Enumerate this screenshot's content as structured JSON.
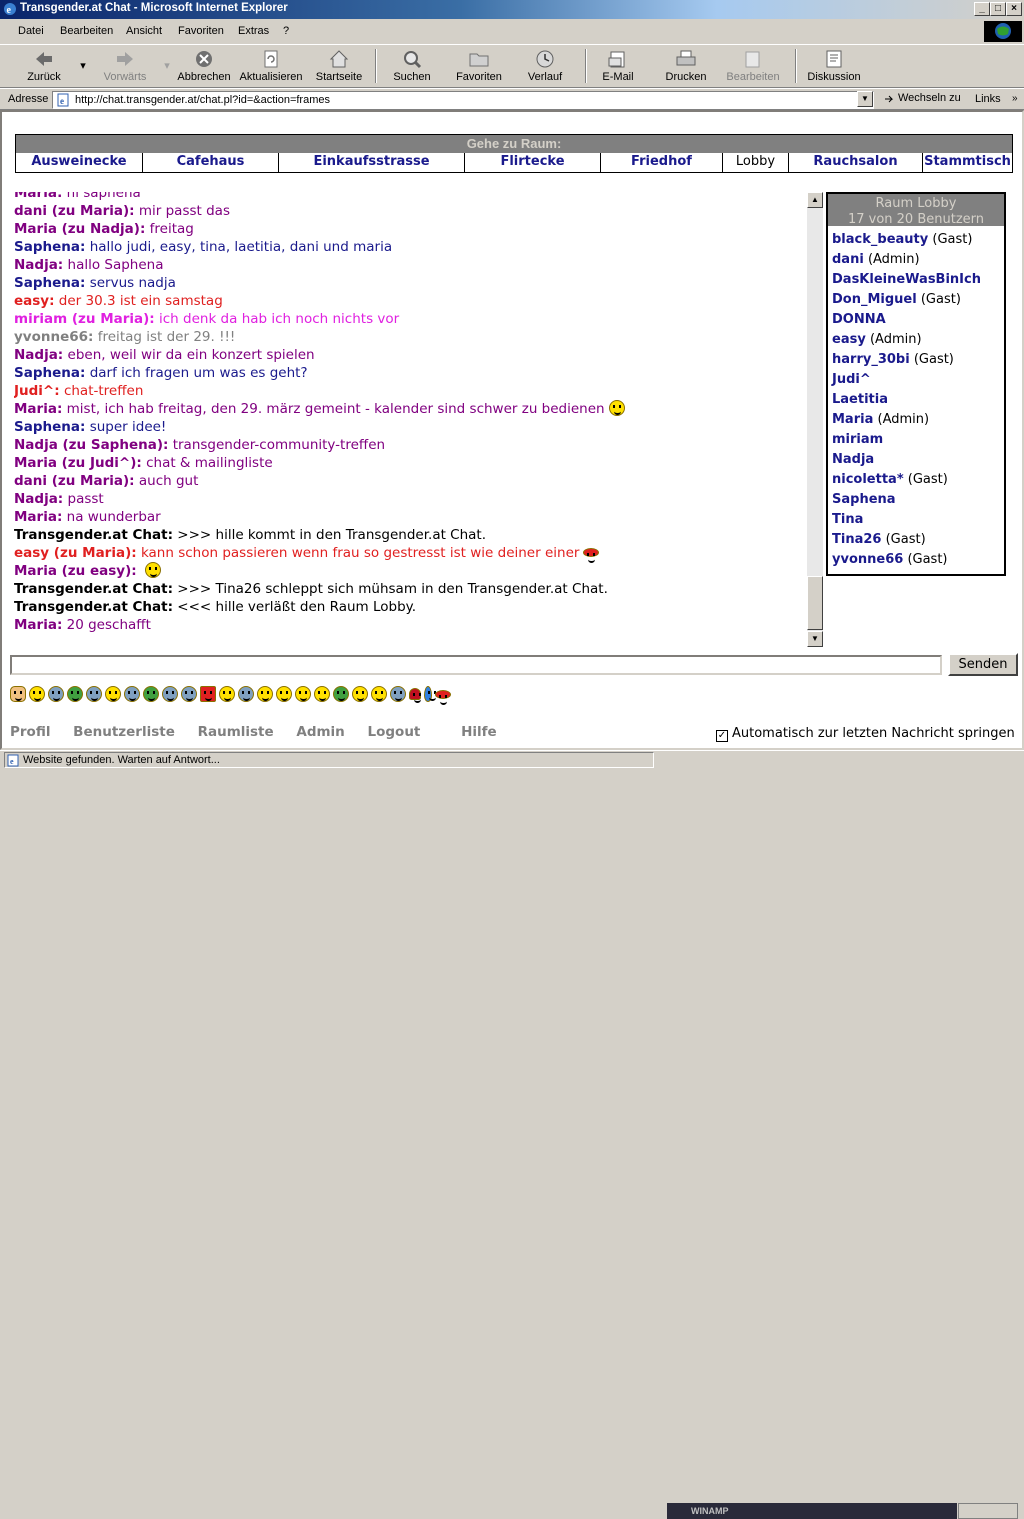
{
  "window": {
    "title": "Transgender.at Chat - Microsoft Internet Explorer"
  },
  "menu": [
    "Datei",
    "Bearbeiten",
    "Ansicht",
    "Favoriten",
    "Extras",
    "?"
  ],
  "toolbar": {
    "back": "Zurück",
    "forward": "Vorwärts",
    "stop": "Abbrechen",
    "refresh": "Aktualisieren",
    "home": "Startseite",
    "search": "Suchen",
    "favorites": "Favoriten",
    "history": "Verlauf",
    "mail": "E-Mail",
    "print": "Drucken",
    "edit": "Bearbeiten",
    "discuss": "Diskussion"
  },
  "address": {
    "label": "Adresse",
    "url": "http://chat.transgender.at/chat.pl?id=&action=frames",
    "go": "Wechseln zu",
    "links": "Links"
  },
  "rooms": {
    "header": "Gehe zu Raum:",
    "items": [
      "Ausweinecke",
      "Cafehaus",
      "Einkaufsstrasse",
      "Flirtecke",
      "Friedhof",
      "Lobby",
      "Rauchsalon",
      "Stammtisch"
    ],
    "current": "Lobby"
  },
  "chat": [
    {
      "who": "Maria:",
      "text": "hi saphena",
      "color": "#800080"
    },
    {
      "who": "dani (zu Maria):",
      "text": "mir passt das",
      "color": "#800080"
    },
    {
      "who": "Maria (zu Nadja):",
      "text": "freitag",
      "color": "#800080"
    },
    {
      "who": "Saphena:",
      "text": "hallo judi, easy, tina, laetitia, dani und maria",
      "color": "#1a1a8c"
    },
    {
      "who": "Nadja:",
      "text": "hallo Saphena",
      "color": "#800080"
    },
    {
      "who": "Saphena:",
      "text": "servus nadja",
      "color": "#1a1a8c"
    },
    {
      "who": "easy:",
      "text": "der 30.3 ist ein samstag",
      "color": "#e02020"
    },
    {
      "who": "miriam (zu Maria):",
      "text": "ich denk da hab ich noch nichts vor",
      "color": "#e020e0"
    },
    {
      "who": "yvonne66:",
      "text": "freitag ist der 29. !!!",
      "color": "#808080"
    },
    {
      "who": "Nadja:",
      "text": "eben, weil wir da ein konzert spielen",
      "color": "#800080"
    },
    {
      "who": "Saphena:",
      "text": "darf ich fragen um was es geht?",
      "color": "#1a1a8c"
    },
    {
      "who": "Judi^:",
      "text": "chat-treffen",
      "color": "#e02020"
    },
    {
      "who": "Maria:",
      "text": "mist, ich hab freitag, den 29. märz gemeint - kalender sind schwer zu bedienen",
      "color": "#800080",
      "emoji": true
    },
    {
      "who": "Saphena:",
      "text": "super idee!",
      "color": "#1a1a8c"
    },
    {
      "who": "Nadja (zu Saphena):",
      "text": "transgender-community-treffen",
      "color": "#800080"
    },
    {
      "who": "Maria (zu Judi^):",
      "text": "chat & mailingliste",
      "color": "#800080"
    },
    {
      "who": "dani (zu Maria):",
      "text": "auch gut",
      "color": "#800080"
    },
    {
      "who": "Nadja:",
      "text": "passt",
      "color": "#800080"
    },
    {
      "who": "Maria:",
      "text": "na wunderbar",
      "color": "#800080"
    },
    {
      "who": "Transgender.at Chat:",
      "text": ">>> hille kommt in den Transgender.at Chat.",
      "color": "#000000"
    },
    {
      "who": "easy (zu Maria):",
      "text": "kann schon passieren wenn frau so gestresst ist wie deiner einer",
      "color": "#e02020",
      "emoji": "lips"
    },
    {
      "who": "Maria (zu easy):",
      "text": "",
      "color": "#800080",
      "emoji": true
    },
    {
      "who": "Transgender.at Chat:",
      "text": ">>> Tina26 schleppt sich mühsam in den Transgender.at Chat.",
      "color": "#000000"
    },
    {
      "who": "Transgender.at Chat:",
      "text": "<<< hille verläßt den Raum Lobby.",
      "color": "#000000"
    },
    {
      "who": "Maria:",
      "text": "20 geschafft",
      "color": "#800080"
    }
  ],
  "userlist": {
    "title": "Raum Lobby",
    "count": "17 von 20 Benutzern",
    "users": [
      {
        "name": "black_beauty",
        "role": "(Gast)"
      },
      {
        "name": "dani",
        "role": "(Admin)"
      },
      {
        "name": "DasKleineWasBinIch",
        "role": ""
      },
      {
        "name": "Don_Miguel",
        "role": "(Gast)"
      },
      {
        "name": "DONNA",
        "role": ""
      },
      {
        "name": "easy",
        "role": "(Admin)"
      },
      {
        "name": "harry_30bi",
        "role": "(Gast)"
      },
      {
        "name": "Judi^",
        "role": ""
      },
      {
        "name": "Laetitia",
        "role": ""
      },
      {
        "name": "Maria",
        "role": "(Admin)"
      },
      {
        "name": "miriam",
        "role": ""
      },
      {
        "name": "Nadja",
        "role": ""
      },
      {
        "name": "nicoletta*",
        "role": "(Gast)"
      },
      {
        "name": "Saphena",
        "role": ""
      },
      {
        "name": "Tina",
        "role": ""
      },
      {
        "name": "Tina26",
        "role": "(Gast)"
      },
      {
        "name": "yvonne66",
        "role": "(Gast)"
      }
    ]
  },
  "input": {
    "send": "Senden",
    "value": ""
  },
  "footer": {
    "links": [
      "Profil",
      "Benutzerliste",
      "Raumliste",
      "Admin",
      "Logout",
      "Hilfe"
    ],
    "autoscroll": "Automatisch zur letzten Nachricht springen",
    "autoscroll_checked": "✓"
  },
  "status": {
    "text": "Website gefunden. Warten auf Antwort...",
    "winamp": "WINAMP"
  }
}
